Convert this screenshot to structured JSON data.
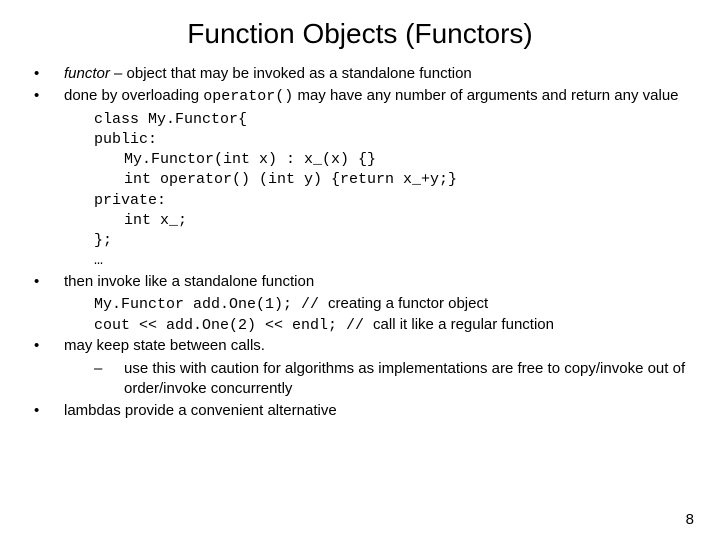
{
  "title": "Function Objects (Functors)",
  "b1": {
    "term": "functor",
    "rest": " – object that may be invoked as a standalone function"
  },
  "b2": {
    "pre": "done by overloading ",
    "op": "operator()",
    "post": " may have any number of arguments and return any value"
  },
  "code": {
    "l1": "class My.Functor{",
    "l2": "public:",
    "l3": "My.Functor(int x) : x_(x) {}",
    "l4": "int operator() (int y) {return x_+y;}",
    "l5": "private:",
    "l6": "int x_;",
    "l7": "};",
    "l8": "…"
  },
  "b3": "then invoke like a standalone function",
  "inv": {
    "l1a": "My.Functor add.One(1); // ",
    "l1b": "creating a functor object",
    "l2a": "cout << add.One(2) << endl; // ",
    "l2b": "call it like a regular function"
  },
  "b4": "may keep state between calls.",
  "b4sub": "use this with caution for algorithms as implementations are free to copy/invoke out of order/invoke concurrently",
  "b5": "lambdas provide a convenient alternative",
  "page": "8"
}
